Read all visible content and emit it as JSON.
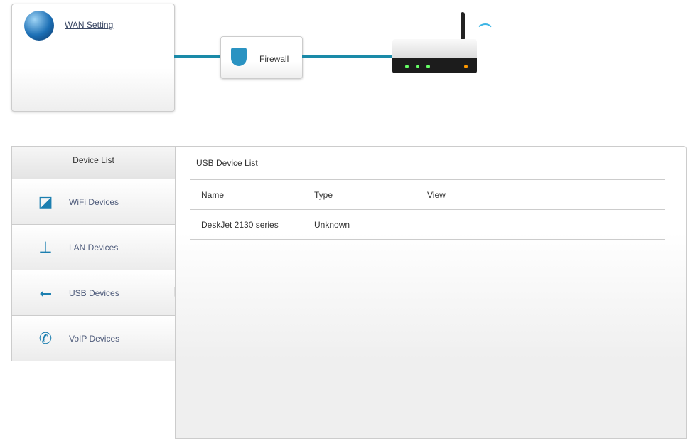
{
  "topology": {
    "wan_label": "WAN Setting",
    "firewall_label": "Firewall"
  },
  "sidebar": {
    "title": "Device List",
    "items": [
      {
        "label": "WiFi Devices",
        "icon": "wifi-device-icon"
      },
      {
        "label": "LAN Devices",
        "icon": "network-icon"
      },
      {
        "label": "USB Devices",
        "icon": "usb-icon"
      },
      {
        "label": "VoIP Devices",
        "icon": "phone-icon"
      }
    ],
    "selected": "USB Devices"
  },
  "main": {
    "title": "USB Device List",
    "columns": [
      "Name",
      "Type",
      "View"
    ],
    "rows": [
      {
        "name": "DeskJet 2130 series",
        "type": "Unknown",
        "view": ""
      }
    ]
  },
  "colors": {
    "accent": "#1a8aa8",
    "link": "#3d4a66"
  }
}
